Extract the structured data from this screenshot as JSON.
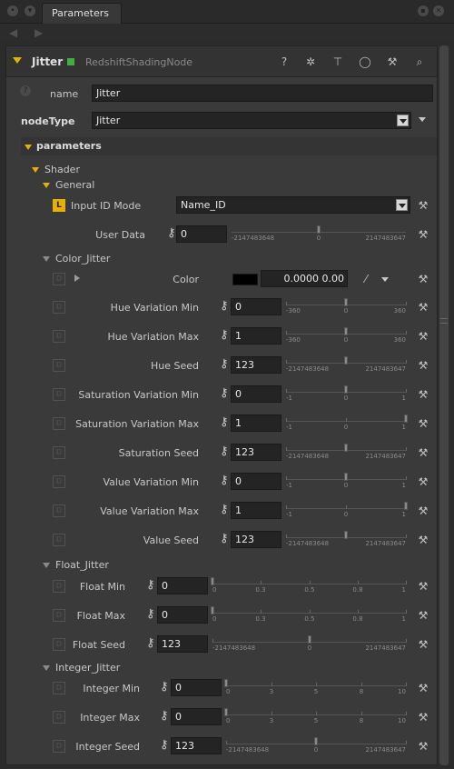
{
  "tabbar": {
    "tab_label": "Parameters"
  },
  "node": {
    "title": "Jitter",
    "type": "RedshiftShadingNode"
  },
  "basic": {
    "name_label": "name",
    "name_value": "Jitter",
    "nodetype_label": "nodeType",
    "nodetype_value": "Jitter"
  },
  "parameters_label": "parameters",
  "shader_label": "Shader",
  "general_label": "General",
  "input_id": {
    "badge": "L",
    "label": "Input ID Mode",
    "value": "Name_ID"
  },
  "user_data": {
    "label": "User Data",
    "value": "0",
    "min": "-2147483648",
    "mid": "0",
    "max": "2147483647"
  },
  "color_jitter": {
    "label": "Color_Jitter",
    "color_label": "Color",
    "color_value": "0.0000  0.00",
    "swatch": "#000000",
    "rows": [
      {
        "label": "Hue Variation Min",
        "value": "0",
        "ticks": [
          "-360",
          "0",
          "360"
        ]
      },
      {
        "label": "Hue Variation Max",
        "value": "1",
        "ticks": [
          "-360",
          "0",
          "360"
        ]
      },
      {
        "label": "Hue Seed",
        "value": "123",
        "ticks": [
          "-2147483648",
          "2147483647"
        ]
      },
      {
        "label": "Saturation Variation Min",
        "value": "0",
        "ticks": [
          "-1",
          "0",
          "1"
        ]
      },
      {
        "label": "Saturation Variation Max",
        "value": "1",
        "ticks": [
          "-1",
          "0",
          "1"
        ]
      },
      {
        "label": "Saturation Seed",
        "value": "123",
        "ticks": [
          "-2147483648",
          "2147483647"
        ]
      },
      {
        "label": "Value Variation Min",
        "value": "0",
        "ticks": [
          "-1",
          "0",
          "1"
        ]
      },
      {
        "label": "Value Variation Max",
        "value": "1",
        "ticks": [
          "-1",
          "0",
          "1"
        ]
      },
      {
        "label": "Value Seed",
        "value": "123",
        "ticks": [
          "-2147483648",
          "2147483647"
        ]
      }
    ]
  },
  "float_jitter": {
    "label": "Float_Jitter",
    "rows": [
      {
        "label": "Float Min",
        "value": "0",
        "ticks": [
          "0",
          "0.3",
          "0.5",
          "0.8",
          "1"
        ]
      },
      {
        "label": "Float Max",
        "value": "0",
        "ticks": [
          "0",
          "0.3",
          "0.5",
          "0.8",
          "1"
        ]
      },
      {
        "label": "Float Seed",
        "value": "123",
        "ticks": [
          "-2147483648",
          "0",
          "2147483647"
        ]
      }
    ]
  },
  "integer_jitter": {
    "label": "Integer_Jitter",
    "rows": [
      {
        "label": "Integer Min",
        "value": "0",
        "ticks": [
          "0",
          "3",
          "5",
          "8",
          "10"
        ]
      },
      {
        "label": "Integer Max",
        "value": "0",
        "ticks": [
          "0",
          "3",
          "5",
          "8",
          "10"
        ]
      },
      {
        "label": "Integer Seed",
        "value": "123",
        "ticks": [
          "-2147483648",
          "0",
          "2147483647"
        ]
      }
    ]
  },
  "colors": {
    "accent": "#e8b000",
    "panel": "#3a3a3a",
    "field": "#242424"
  }
}
